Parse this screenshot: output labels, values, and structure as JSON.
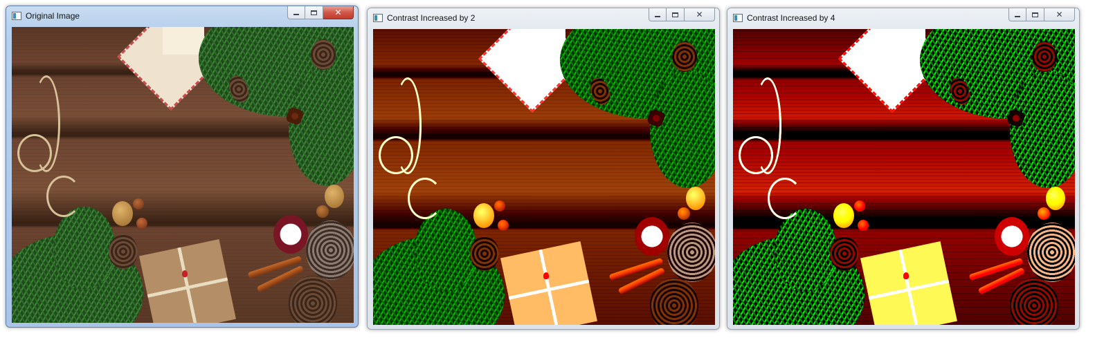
{
  "windows": [
    {
      "id": "original",
      "title": "Original Image",
      "state": "active",
      "controls": {
        "minimize_icon": "minimize-icon",
        "maximize_icon": "maximize-icon",
        "close_icon": "close-icon",
        "close_glyph": "✕"
      }
    },
    {
      "id": "contrast2",
      "title": "Contrast Increased by 2",
      "state": "inactive",
      "controls": {
        "minimize_icon": "minimize-icon",
        "maximize_icon": "maximize-icon",
        "close_icon": "close-icon",
        "close_glyph": "✕"
      }
    },
    {
      "id": "contrast4",
      "title": "Contrast Increased by 4",
      "state": "inactive",
      "controls": {
        "minimize_icon": "minimize-icon",
        "maximize_icon": "maximize-icon",
        "close_icon": "close-icon",
        "close_glyph": "✕"
      }
    }
  ],
  "colors": {
    "active_close": "#c13b2c",
    "wood": "#6e4430",
    "pine": "#2f6b2a"
  }
}
